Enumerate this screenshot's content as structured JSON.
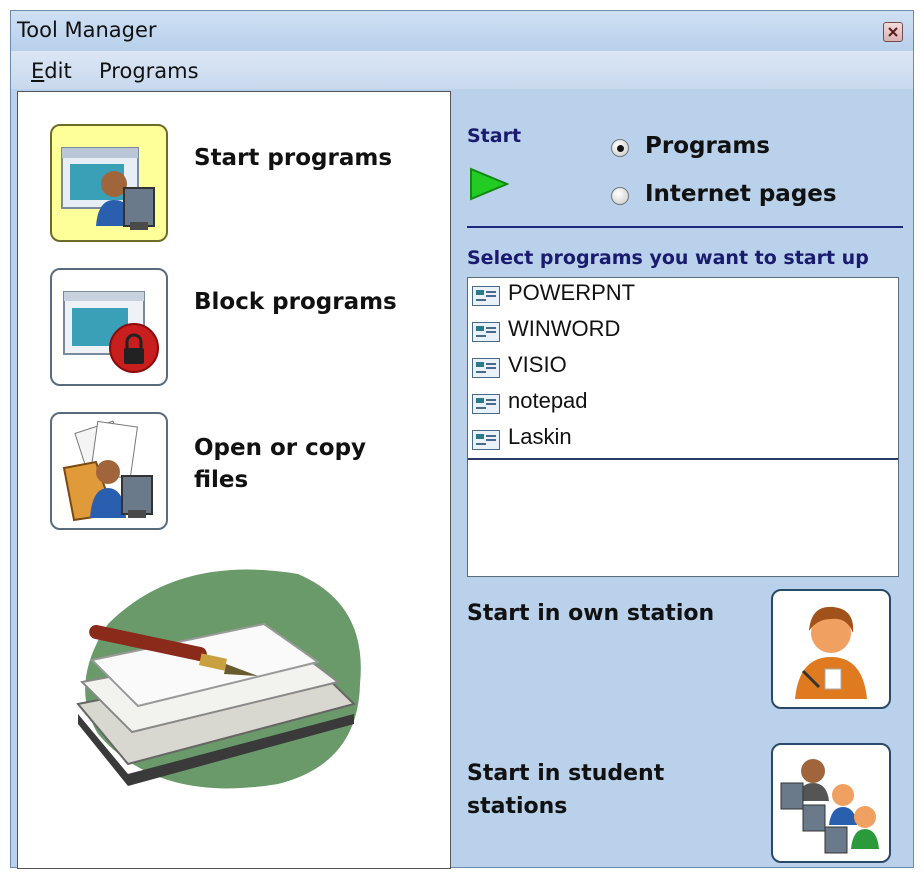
{
  "window": {
    "title": "Tool Manager"
  },
  "menu": {
    "items": [
      {
        "accel": "E",
        "rest": "dit"
      },
      {
        "accel": "",
        "rest": "Programs"
      }
    ]
  },
  "tools": [
    {
      "label_line1": "Start programs",
      "label_line2": "",
      "icon": "start-programs-icon",
      "active": true
    },
    {
      "label_line1": "Block programs",
      "label_line2": "",
      "icon": "block-programs-icon",
      "active": false
    },
    {
      "label_line1": "Open or copy",
      "label_line2": "files",
      "icon": "open-copy-files-icon",
      "active": false
    }
  ],
  "start_section": {
    "label": "Start",
    "options": [
      {
        "label": "Programs",
        "selected": true
      },
      {
        "label": "Internet pages",
        "selected": false
      }
    ]
  },
  "programs": {
    "header": "Select programs you want to start up",
    "items": [
      "POWERPNT",
      "WINWORD",
      "VISIO",
      "notepad",
      "Laskin"
    ]
  },
  "actions": {
    "own_station_line1": "Start in own station",
    "student_stations_line1": "Start in student",
    "student_stations_line2": "stations"
  },
  "colors": {
    "window_bg": "#b9d1ea",
    "selected_tile": "#ffff99",
    "play_green": "#22cc22",
    "heading_blue": "#1a1a6e"
  }
}
